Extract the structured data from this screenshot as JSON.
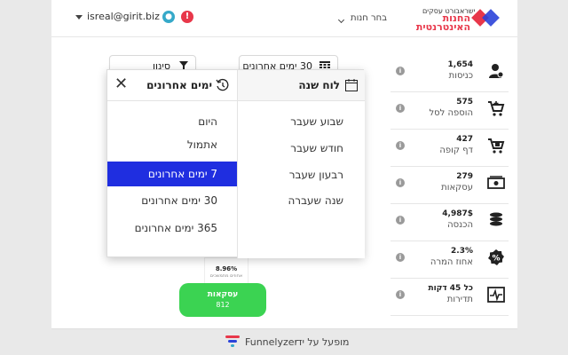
{
  "header": {
    "user_email": "isreal@girit.biz",
    "store_select": "בחר חנות",
    "brand_top": "ישראבורט עסקים",
    "brand_line1": "החנות",
    "brand_line2": "האינטרנטית"
  },
  "toolbar": {
    "filter_label": "סינון",
    "range_label": "30 ימים אחרונים"
  },
  "dropdown": {
    "recent_title": "ימים אחרונים",
    "calendar_title": "לוח שנה",
    "recent_options": [
      "היום",
      "אתמול",
      "7 ימים אחרונים",
      "30 ימים אחרונים",
      "365 ימים אחרונים"
    ],
    "calendar_options": [
      "שבוע שעבר",
      "חודש שעבר",
      "רבעון שעבר",
      "שנה שעברה"
    ],
    "selected_option": "7 ימים אחרונים"
  },
  "funnel": {
    "conversion_pct": "8.96%",
    "conversion_sub": "אחוזים מתמשכים",
    "deals_label": "עסקאות",
    "deals_value": "812",
    "button_color": "#3bd352"
  },
  "stats": [
    {
      "value": "1,654",
      "label": "כניסות",
      "icon": "user-icon"
    },
    {
      "value": "575",
      "label": "הוספה לסל",
      "icon": "cart-add-icon"
    },
    {
      "value": "427",
      "label": "דף קופה",
      "icon": "checkout-icon"
    },
    {
      "value": "279",
      "label": "עסקאות",
      "icon": "money-icon"
    },
    {
      "value": "4,987$",
      "label": "הכנסה",
      "icon": "coins-icon"
    },
    {
      "value": "2.3%",
      "label": "אחוז המרה",
      "icon": "percent-icon"
    },
    {
      "value": "כל 45 דקות",
      "label": "תדירות",
      "icon": "pulse-icon"
    }
  ],
  "footer": {
    "powered_by": "מופעל על ידי",
    "brand": "Funnelyzer"
  },
  "colors": {
    "accent_blue": "#1f2ee0",
    "brand_red": "#e8374a",
    "brand_blue": "#2b43d9",
    "green": "#3bd352"
  }
}
